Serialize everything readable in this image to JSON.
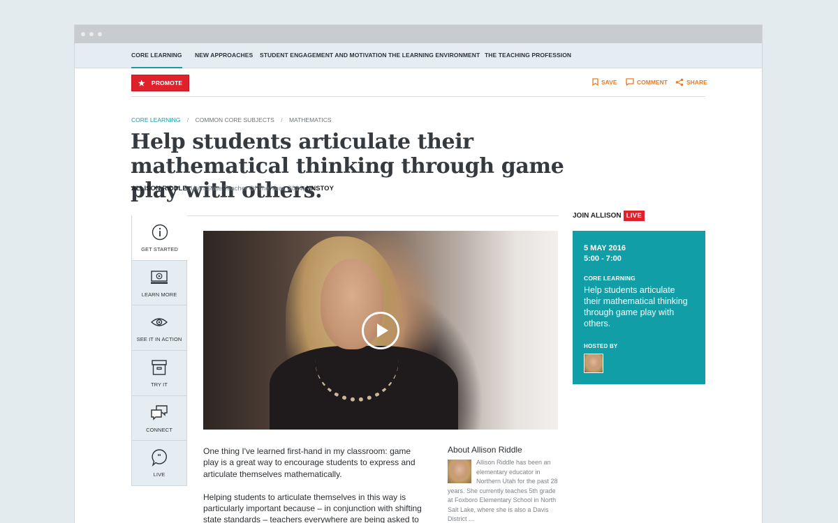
{
  "topnav": {
    "items": [
      {
        "label": "CORE LEARNING",
        "active": true
      },
      {
        "label": "NEW APPROACHES",
        "active": false
      },
      {
        "label": "STUDENT ENGAGEMENT AND MOTIVATION",
        "active": false
      },
      {
        "label": "THE LEARNING ENVIRONMENT",
        "active": false
      },
      {
        "label": "THE TEACHING PROFESSION",
        "active": false
      }
    ]
  },
  "toolbar": {
    "promote_label": "PROMOTE",
    "save_label": "SAVE",
    "comment_label": "COMMENT",
    "share_label": "SHARE"
  },
  "breadcrumb": [
    "CORE LEARNING",
    "COMMON CORE SUBJECTS",
    "MATHEMATICS"
  ],
  "article": {
    "title": "Help students articulate their mathematical thinking through game play with others.",
    "author_name": "ALLISON RIDDLE",
    "author_role": ", Utah State Teacher Of The Year, 2014,",
    "author_org": "NNSTOY",
    "paragraphs": [
      "One thing I've learned first-hand in my classroom: game play is a great way to encourage students to express and articulate themselves mathematically.",
      "Helping students to articulate themselves in this way is particularly important because – in conjunction with shifting state standards – teachers everywhere are being asked to"
    ]
  },
  "sidenav": {
    "items": [
      {
        "label": "GET STARTED",
        "icon": "info-icon",
        "active": true
      },
      {
        "label": "LEARN MORE",
        "icon": "video-screen-icon",
        "active": false
      },
      {
        "label": "SEE IT IN ACTION",
        "icon": "eye-icon",
        "active": false
      },
      {
        "label": "TRY IT",
        "icon": "archive-box-icon",
        "active": false
      },
      {
        "label": "CONNECT",
        "icon": "chat-bubbles-icon",
        "active": false
      },
      {
        "label": "LIVE",
        "icon": "quote-bubble-icon",
        "active": false
      }
    ]
  },
  "about": {
    "heading": "About Allison Riddle",
    "bio": "Allison Riddle has been an elementary educator in Northern Utah for the past 28 years. She currently teaches 5th grade at Foxboro Elementary School in North Salt Lake, where she is also a Davis District ..."
  },
  "live": {
    "join_label": "JOIN ALLISON",
    "badge": "LIVE",
    "date": "5 MAY 2016",
    "time": "5:00 - 7:00",
    "category": "CORE LEARNING",
    "title": "Help students articulate their mathematical thinking through game play with others.",
    "hosted_by": "HOSTED BY"
  },
  "colors": {
    "accent": "#1a9ba4",
    "promote": "#e0202b",
    "action": "#ec7a1c",
    "event_bg": "#129ea7"
  }
}
